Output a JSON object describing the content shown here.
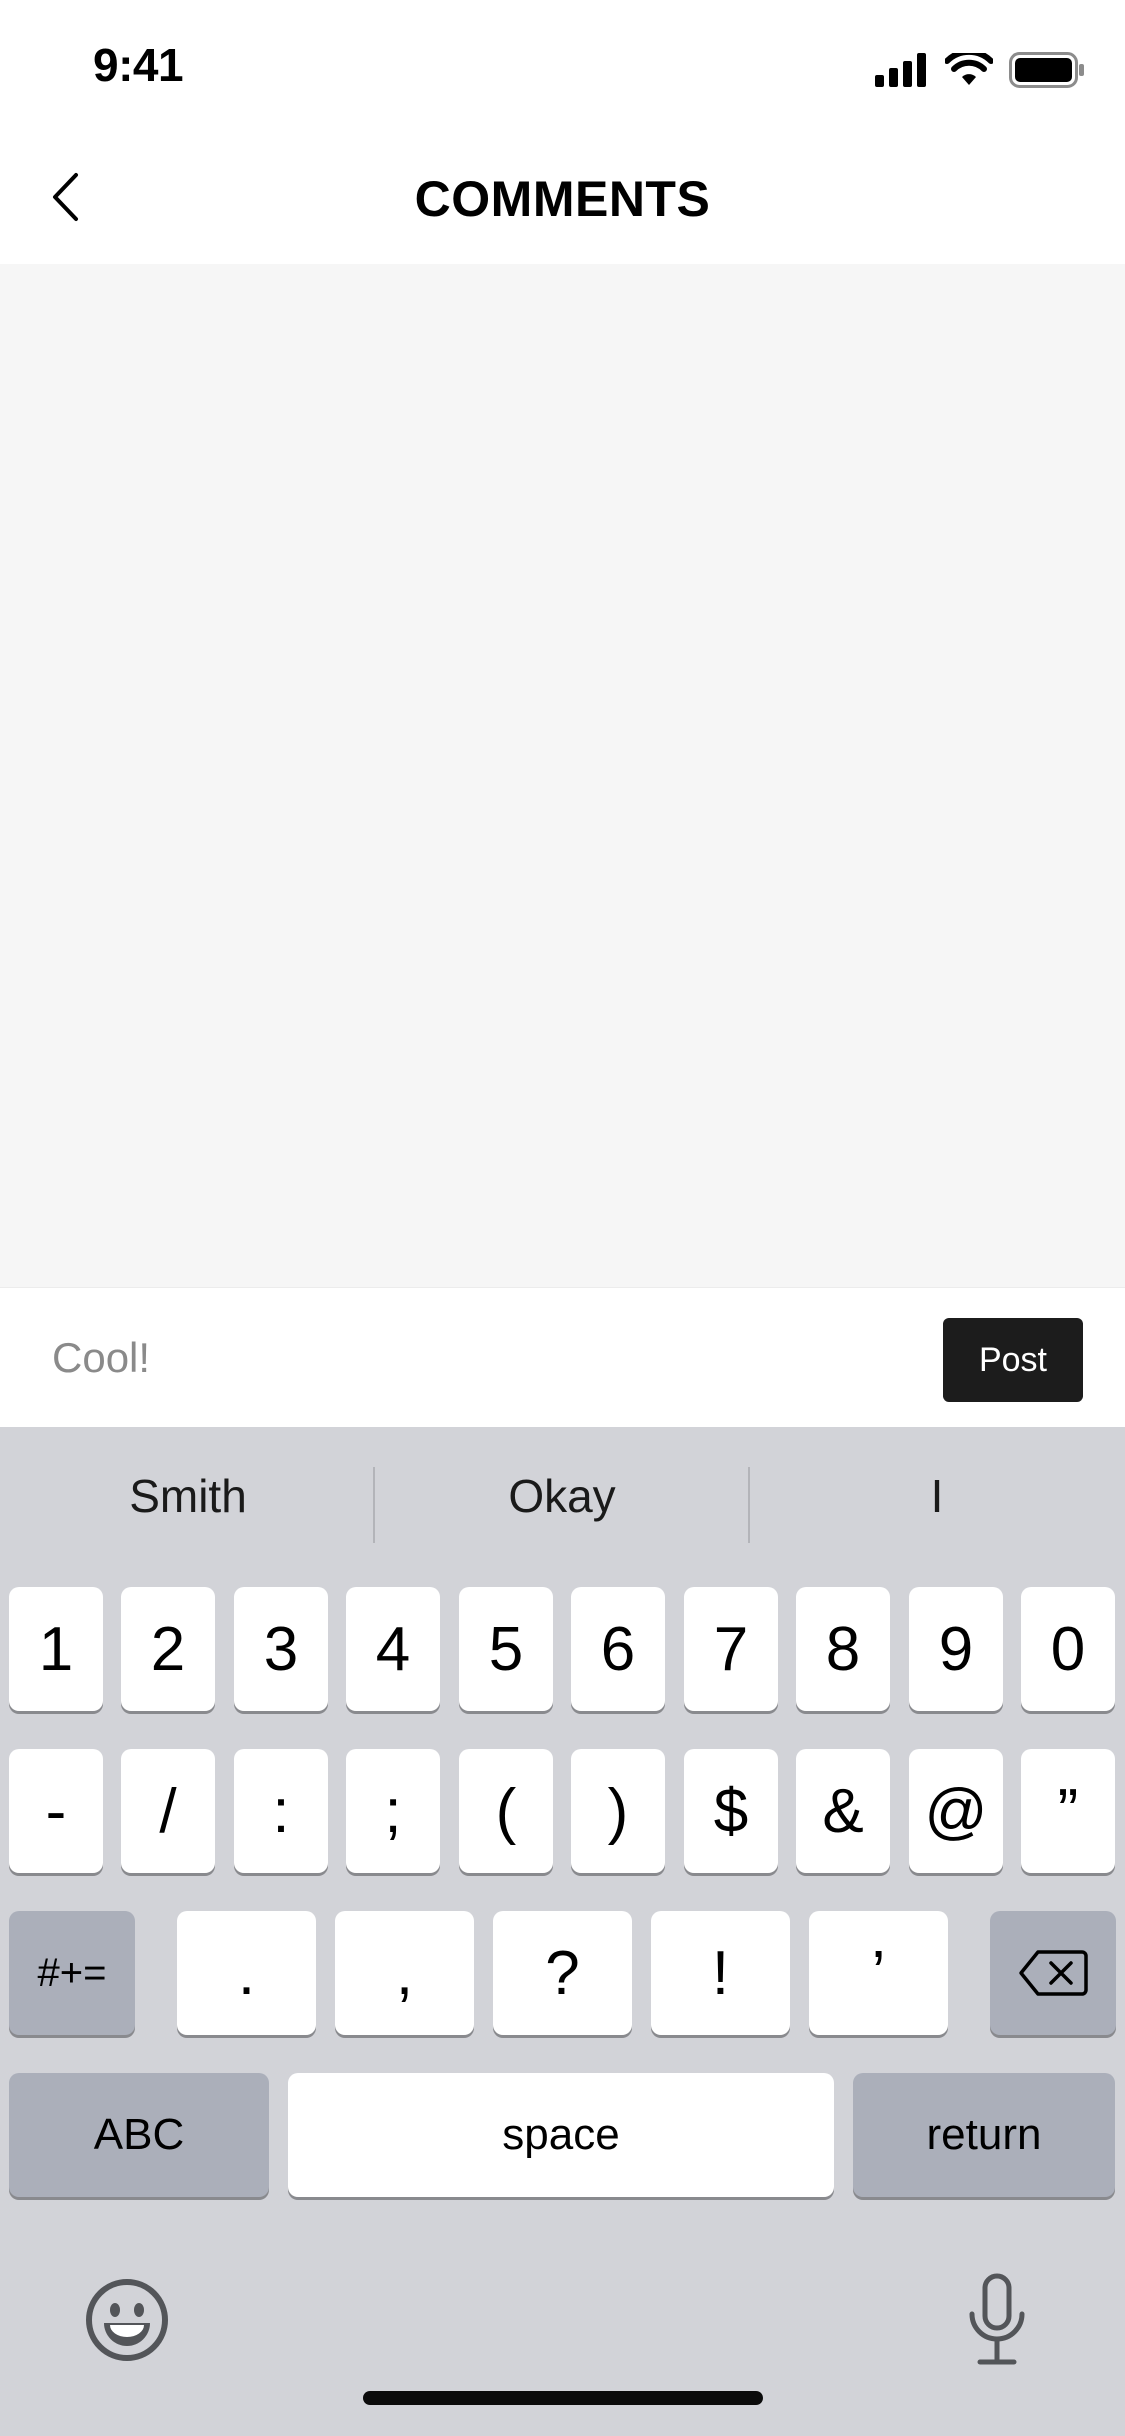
{
  "status_bar": {
    "time": "9:41"
  },
  "nav": {
    "title": "COMMENTS"
  },
  "comment_box": {
    "value": "Cool!",
    "post_label": "Post"
  },
  "keyboard": {
    "suggestions": [
      "Smith",
      "Okay",
      "I"
    ],
    "row1": [
      "1",
      "2",
      "3",
      "4",
      "5",
      "6",
      "7",
      "8",
      "9",
      "0"
    ],
    "row2": [
      "-",
      "/",
      ":",
      ";",
      "(",
      ")",
      "$",
      "&",
      "@",
      "”"
    ],
    "symbols_toggle": "#+=",
    "row3": [
      ".",
      ",",
      "?",
      "!",
      "’"
    ],
    "abc": "ABC",
    "space": "space",
    "return": "return"
  }
}
